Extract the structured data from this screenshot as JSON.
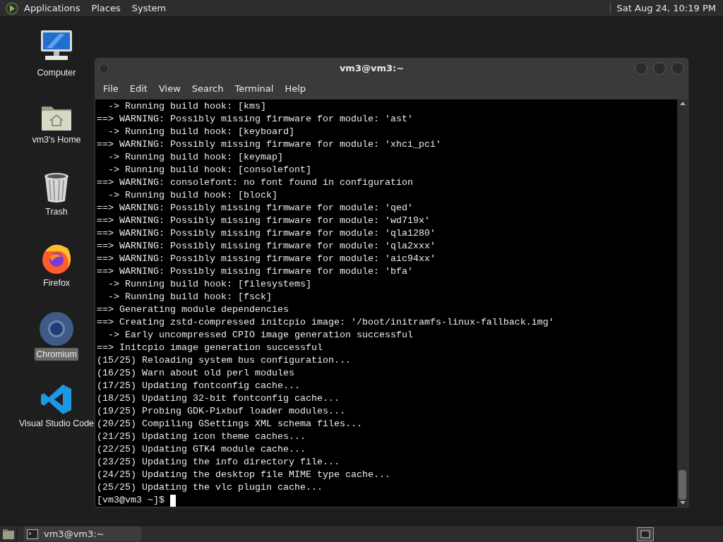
{
  "top_panel": {
    "menus": [
      "Applications",
      "Places",
      "System"
    ],
    "clock": "Sat Aug 24, 10:19 PM"
  },
  "desktop_icons": [
    {
      "kind": "computer",
      "label": "Computer",
      "selected": false
    },
    {
      "kind": "home",
      "label": "vm3's Home",
      "selected": false
    },
    {
      "kind": "trash",
      "label": "Trash",
      "selected": false
    },
    {
      "kind": "firefox",
      "label": "Firefox",
      "selected": false
    },
    {
      "kind": "chromium",
      "label": "Chromium",
      "selected": true
    },
    {
      "kind": "vscode",
      "label": "Visual Studio Code",
      "selected": false
    }
  ],
  "terminal": {
    "title": "vm3@vm3:~",
    "menu": [
      "File",
      "Edit",
      "View",
      "Search",
      "Terminal",
      "Help"
    ],
    "lines": [
      "  -> Running build hook: [kms]",
      "==> WARNING: Possibly missing firmware for module: 'ast'",
      "  -> Running build hook: [keyboard]",
      "==> WARNING: Possibly missing firmware for module: 'xhci_pci'",
      "  -> Running build hook: [keymap]",
      "  -> Running build hook: [consolefont]",
      "==> WARNING: consolefont: no font found in configuration",
      "  -> Running build hook: [block]",
      "==> WARNING: Possibly missing firmware for module: 'qed'",
      "==> WARNING: Possibly missing firmware for module: 'wd719x'",
      "==> WARNING: Possibly missing firmware for module: 'qla1280'",
      "==> WARNING: Possibly missing firmware for module: 'qla2xxx'",
      "==> WARNING: Possibly missing firmware for module: 'aic94xx'",
      "==> WARNING: Possibly missing firmware for module: 'bfa'",
      "  -> Running build hook: [filesystems]",
      "  -> Running build hook: [fsck]",
      "==> Generating module dependencies",
      "==> Creating zstd-compressed initcpio image: '/boot/initramfs-linux-fallback.img'",
      "  -> Early uncompressed CPIO image generation successful",
      "==> Initcpio image generation successful",
      "(15/25) Reloading system bus configuration...",
      "(16/25) Warn about old perl modules",
      "(17/25) Updating fontconfig cache...",
      "(18/25) Updating 32-bit fontconfig cache...",
      "(19/25) Probing GDK-Pixbuf loader modules...",
      "(20/25) Compiling GSettings XML schema files...",
      "(21/25) Updating icon theme caches...",
      "(22/25) Updating GTK4 module cache...",
      "(23/25) Updating the info directory file...",
      "(24/25) Updating the desktop file MIME type cache...",
      "(25/25) Updating the vlc plugin cache..."
    ],
    "prompt": "[vm3@vm3 ~]$"
  },
  "taskbar": {
    "tasks": [
      {
        "label": "vm3@vm3:~",
        "selected": false
      }
    ]
  }
}
